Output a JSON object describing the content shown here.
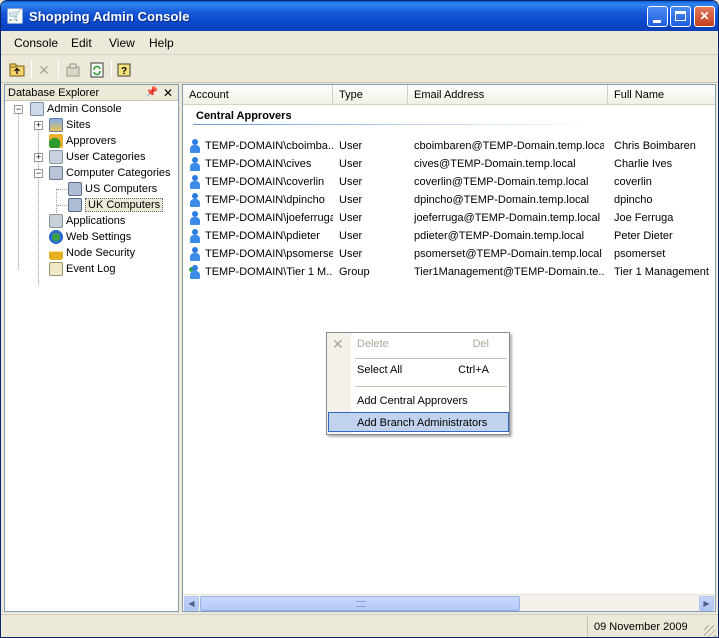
{
  "window": {
    "title": "Shopping Admin Console"
  },
  "menu": [
    {
      "label": "Console"
    },
    {
      "label": "Edit"
    },
    {
      "label": "View"
    },
    {
      "label": "Help"
    }
  ],
  "explorer": {
    "title": "Database Explorer",
    "nodes": [
      {
        "label": "Admin Console",
        "icon": "admin-console-icon"
      },
      {
        "label": "Sites",
        "icon": "sites-icon"
      },
      {
        "label": "Approvers",
        "icon": "approvers-icon"
      },
      {
        "label": "User Categories",
        "icon": "user-categories-icon"
      },
      {
        "label": "Computer Categories",
        "icon": "computer-categories-icon"
      },
      {
        "label": "US Computers",
        "icon": "computers-icon"
      },
      {
        "label": "UK Computers",
        "icon": "computers-icon"
      },
      {
        "label": "Applications",
        "icon": "applications-icon"
      },
      {
        "label": "Web Settings",
        "icon": "web-settings-icon"
      },
      {
        "label": "Node Security",
        "icon": "lock-icon"
      },
      {
        "label": "Event Log",
        "icon": "event-log-icon"
      }
    ]
  },
  "list": {
    "columns": [
      "Account",
      "Type",
      "Email Address",
      "Full Name"
    ],
    "group_title": "Central Approvers",
    "rows": [
      {
        "account": "TEMP-DOMAIN\\cboimba...",
        "type": "User",
        "email": "cboimbaren@TEMP-Domain.temp.local",
        "name": "Chris Boimbaren"
      },
      {
        "account": "TEMP-DOMAIN\\cives",
        "type": "User",
        "email": "cives@TEMP-Domain.temp.local",
        "name": "Charlie Ives"
      },
      {
        "account": "TEMP-DOMAIN\\coverlin",
        "type": "User",
        "email": "coverlin@TEMP-Domain.temp.local",
        "name": "coverlin"
      },
      {
        "account": "TEMP-DOMAIN\\dpincho",
        "type": "User",
        "email": "dpincho@TEMP-Domain.temp.local",
        "name": "dpincho"
      },
      {
        "account": "TEMP-DOMAIN\\joeferruga",
        "type": "User",
        "email": "joeferruga@TEMP-Domain.temp.local",
        "name": "Joe Ferruga"
      },
      {
        "account": "TEMP-DOMAIN\\pdieter",
        "type": "User",
        "email": "pdieter@TEMP-Domain.temp.local",
        "name": "Peter Dieter"
      },
      {
        "account": "TEMP-DOMAIN\\psomerset",
        "type": "User",
        "email": "psomerset@TEMP-Domain.temp.local",
        "name": "psomerset"
      },
      {
        "account": "TEMP-DOMAIN\\Tier 1 M...",
        "type": "Group",
        "email": "Tier1Management@TEMP-Domain.te...",
        "name": "Tier 1 Management"
      }
    ]
  },
  "context_menu": {
    "items": [
      {
        "label": "Delete",
        "shortcut": "Del",
        "disabled": true
      },
      {
        "label": "Select All",
        "shortcut": "Ctrl+A"
      },
      {
        "label": "Add Central Approvers"
      },
      {
        "label": "Add Branch Administrators",
        "highlighted": true
      }
    ]
  },
  "status": {
    "date": "09 November 2009"
  }
}
